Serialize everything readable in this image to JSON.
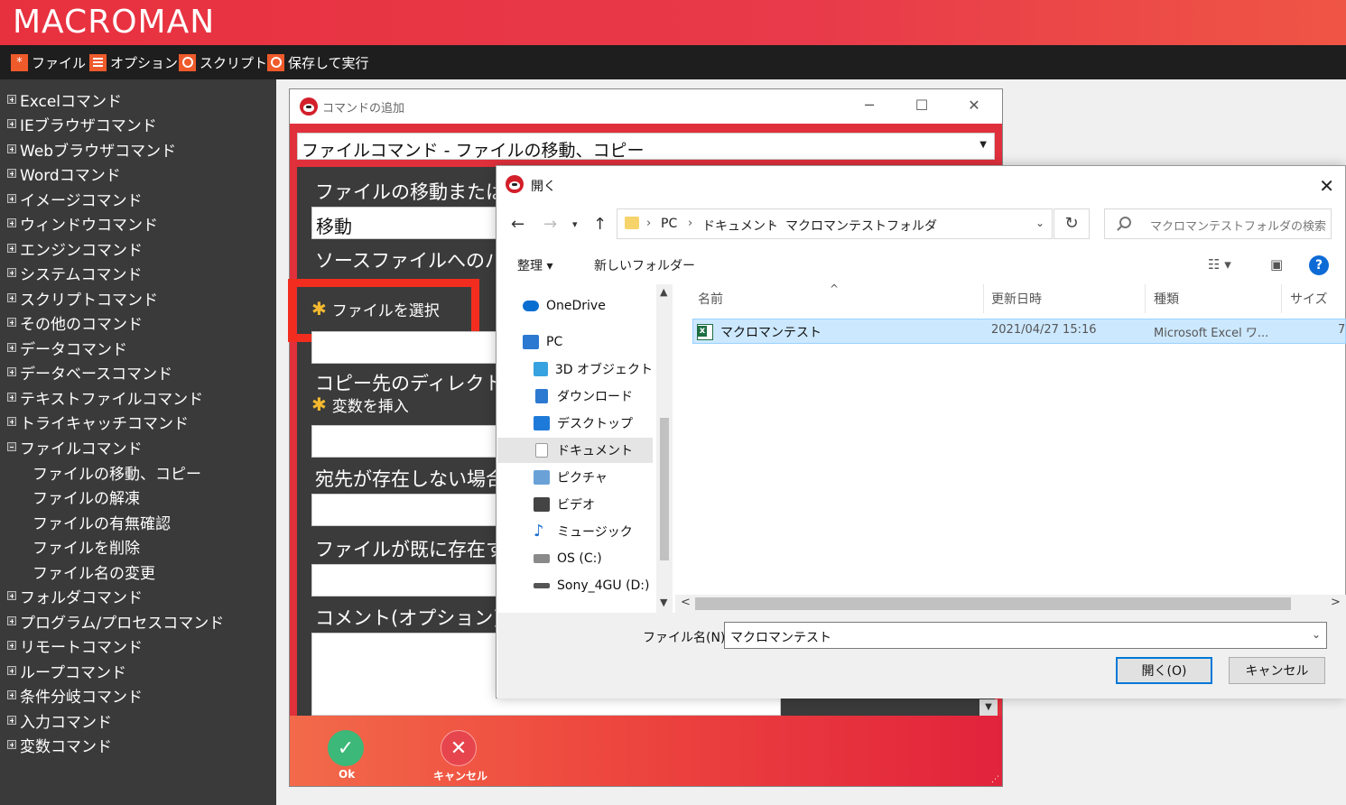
{
  "app": {
    "title": "MACROMAN",
    "menu": [
      {
        "label": "ファイル",
        "icon": "asterisk-icon"
      },
      {
        "label": "オプション",
        "icon": "menu-lines-icon"
      },
      {
        "label": "スクリプト",
        "icon": "circle-icon"
      },
      {
        "label": "保存して実行",
        "icon": "play-circle-icon"
      }
    ]
  },
  "sidebar": {
    "items": [
      "Excelコマンド",
      "IEブラウザコマンド",
      "Webブラウザコマンド",
      "Wordコマンド",
      "イメージコマンド",
      "ウィンドウコマンド",
      "エンジンコマンド",
      "システムコマンド",
      "スクリプトコマンド",
      "その他のコマンド",
      "データコマンド",
      "データベースコマンド",
      "テキストファイルコマンド",
      "トライキャッチコマンド",
      "ファイルコマンド"
    ],
    "file_children": [
      "ファイルの移動、コピー",
      "ファイルの解凍",
      "ファイルの有無確認",
      "ファイルを削除",
      "ファイル名の変更"
    ],
    "items_after": [
      "フォルダコマンド",
      "プログラム/プロセスコマンド",
      "リモートコマンド",
      "ループコマンド",
      "条件分岐コマンド",
      "入力コマンド",
      "変数コマンド"
    ]
  },
  "cmd_dialog": {
    "title": "コマンドの追加",
    "selected_command": "ファイルコマンド - ファイルの移動、コピー",
    "labels": {
      "move_or_copy": "ファイルの移動または",
      "source_path": "ソースファイルへのパ",
      "dest_dir": "コピー先のディレクト",
      "dest_not_exist": "宛先が存在しない場合",
      "file_exists": "ファイルが既に存在す",
      "comment": "コメント(オプション)"
    },
    "move_value": "移動",
    "select_file_link": "ファイルを選択",
    "insert_variable_link": "変数を挿入",
    "ok_label": "Ok",
    "cancel_label": "キャンセル"
  },
  "file_dialog": {
    "title": "開く",
    "breadcrumb": [
      "PC",
      "ドキュメント",
      "マクロマンテストフォルダ"
    ],
    "search_placeholder": "マクロマンテストフォルダの検索",
    "toolbar": {
      "organize": "整理 ▾",
      "new_folder": "新しいフォルダー"
    },
    "nav_items": [
      {
        "label": "OneDrive",
        "icon": "cloud-icon",
        "color": "#0a6ed1"
      },
      {
        "label": "PC",
        "icon": "pc-icon",
        "color": "#2b79d0"
      },
      {
        "label": "3D オブジェクト",
        "icon": "cube-icon",
        "color": "#37a2e0"
      },
      {
        "label": "ダウンロード",
        "icon": "download-icon",
        "color": "#2b79d0"
      },
      {
        "label": "デスクトップ",
        "icon": "desktop-icon",
        "color": "#1e7ad8"
      },
      {
        "label": "ドキュメント",
        "icon": "document-icon",
        "color": "#9a9a9a"
      },
      {
        "label": "ピクチャ",
        "icon": "picture-icon",
        "color": "#6aa2d8"
      },
      {
        "label": "ビデオ",
        "icon": "video-icon",
        "color": "#444444"
      },
      {
        "label": "ミュージック",
        "icon": "music-icon",
        "color": "#1e6fd0"
      },
      {
        "label": "OS (C:)",
        "icon": "drive-icon",
        "color": "#8a8a8a"
      },
      {
        "label": "Sony_4GU (D:)",
        "icon": "usb-drive-icon",
        "color": "#555555"
      }
    ],
    "columns": [
      "名前",
      "更新日時",
      "種類",
      "サイズ"
    ],
    "files": [
      {
        "name": "マクロマンテスト",
        "modified": "2021/04/27 15:16",
        "type": "Microsoft Excel ワ...",
        "size": "7"
      }
    ],
    "filename_label": "ファイル名(N):",
    "filename_value": "マクロマンテスト",
    "open_button": "開く(O)",
    "cancel_button": "キャンセル"
  },
  "colors": {
    "brand_red": "#e8313f",
    "highlight_red": "#f22d1f",
    "selection_blue": "#cce8ff"
  }
}
